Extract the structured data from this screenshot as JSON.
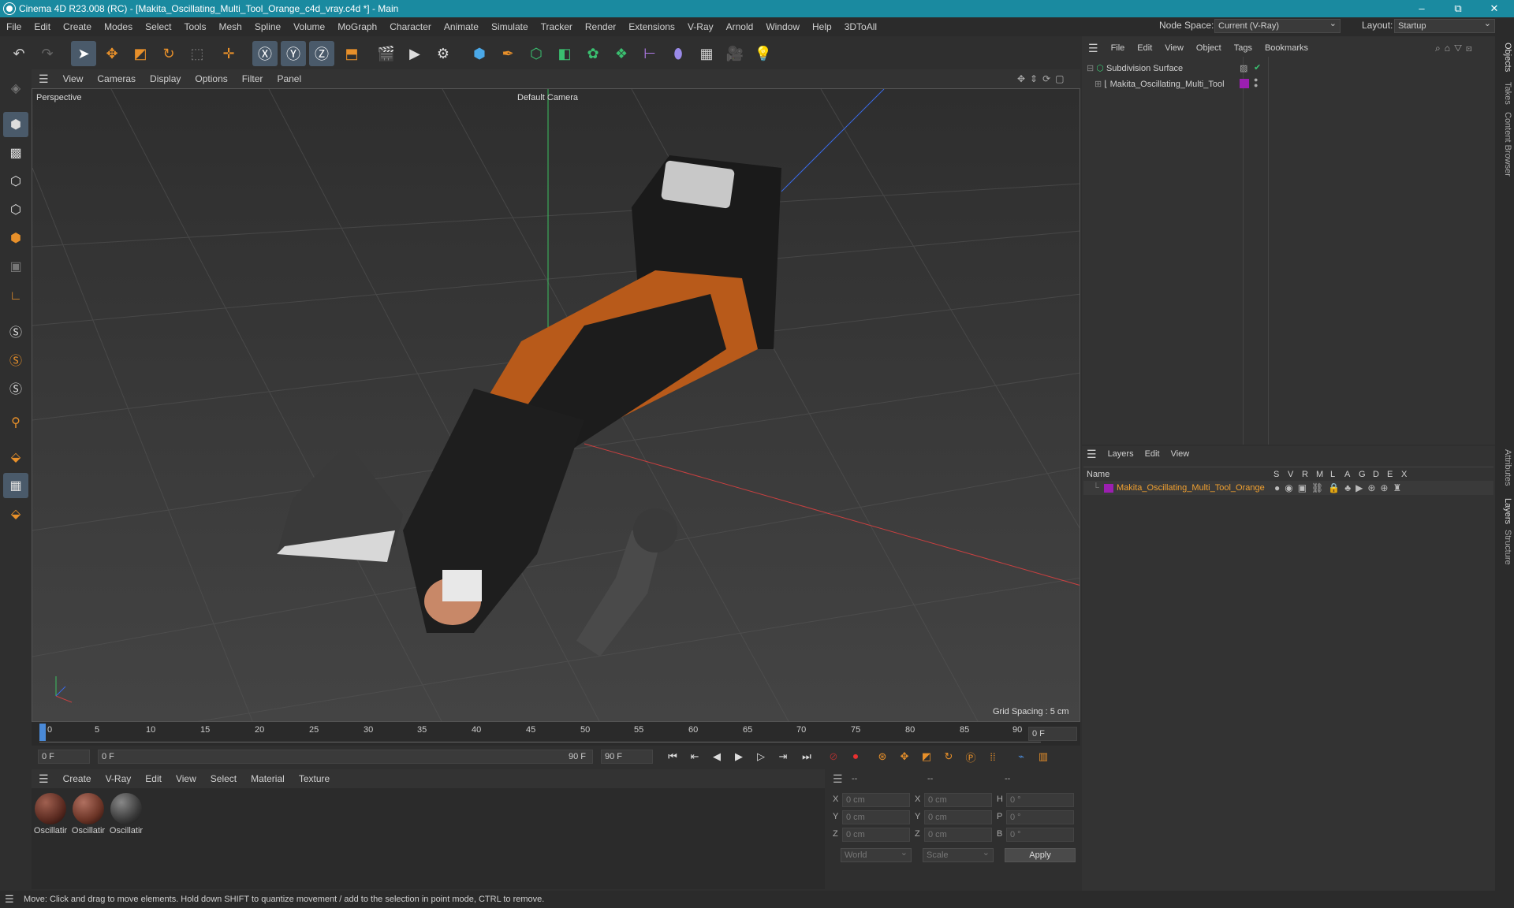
{
  "window": {
    "title": "Cinema 4D R23.008 (RC) - [Makita_Oscillating_Multi_Tool_Orange_c4d_vray.c4d *] - Main",
    "minimize": "–",
    "restore": "⧉",
    "close": "✕"
  },
  "menu": [
    "File",
    "Edit",
    "Create",
    "Modes",
    "Select",
    "Tools",
    "Mesh",
    "Spline",
    "Volume",
    "MoGraph",
    "Character",
    "Animate",
    "Simulate",
    "Tracker",
    "Render",
    "Extensions",
    "V-Ray",
    "Arnold",
    "Window",
    "Help",
    "3DToAll"
  ],
  "node_space": {
    "label": "Node Space:",
    "value": "Current (V-Ray)"
  },
  "layout": {
    "label": "Layout:",
    "value": "Startup"
  },
  "viewport": {
    "menu": [
      "View",
      "Cameras",
      "Display",
      "Options",
      "Filter",
      "Panel"
    ],
    "name": "Perspective",
    "camera": "Default Camera",
    "grid_spacing": "Grid Spacing : 5 cm"
  },
  "timeline": {
    "ticks": [
      "0",
      "5",
      "10",
      "15",
      "20",
      "25",
      "30",
      "35",
      "40",
      "45",
      "50",
      "55",
      "60",
      "65",
      "70",
      "75",
      "80",
      "85",
      "90"
    ],
    "current_frame": "0 F",
    "start_field": "0 F",
    "range_start": "0 F",
    "range_end": "90 F",
    "end_field": "90 F"
  },
  "material_panel": {
    "menu": [
      "Create",
      "V-Ray",
      "Edit",
      "View",
      "Select",
      "Material",
      "Texture"
    ],
    "materials": [
      {
        "name": "Oscillatir",
        "color": "#5a2a20"
      },
      {
        "name": "Oscillatir",
        "color": "#6a3325"
      },
      {
        "name": "Oscillatir",
        "color": "#3a3a3a"
      }
    ]
  },
  "coordinates": {
    "headers": [
      "--",
      "--",
      "--"
    ],
    "rows": [
      {
        "a": "X",
        "av": "0 cm",
        "b": "X",
        "bv": "0 cm",
        "c": "H",
        "cv": "0 °"
      },
      {
        "a": "Y",
        "av": "0 cm",
        "b": "Y",
        "bv": "0 cm",
        "c": "P",
        "cv": "0 °"
      },
      {
        "a": "Z",
        "av": "0 cm",
        "b": "Z",
        "bv": "0 cm",
        "c": "B",
        "cv": "0 °"
      }
    ],
    "mode": "World",
    "scale": "Scale",
    "apply": "Apply"
  },
  "objects_panel": {
    "menu": [
      "File",
      "Edit",
      "View",
      "Object",
      "Tags",
      "Bookmarks"
    ],
    "items": [
      {
        "name": "Subdivision Surface"
      },
      {
        "name": "Makita_Oscillating_Multi_Tool"
      }
    ]
  },
  "layers_panel": {
    "menu": [
      "Layers",
      "Edit",
      "View"
    ],
    "columns": [
      "Name",
      "S",
      "V",
      "R",
      "M",
      "L",
      "A",
      "G",
      "D",
      "E",
      "X"
    ],
    "layer": {
      "name": "Makita_Oscillating_Multi_Tool_Orange",
      "color": "#9b1fb0"
    }
  },
  "side_tabs": [
    "Objects",
    "Takes",
    "Content Browser",
    "Attributes",
    "Layers",
    "Structure"
  ],
  "status": "Move: Click and drag to move elements. Hold down SHIFT to quantize movement / add to the selection in point mode, CTRL to remove.",
  "colors": {
    "accent": "#1a8aa0",
    "orange": "#e8902a",
    "layer_text": "#f0a030"
  }
}
